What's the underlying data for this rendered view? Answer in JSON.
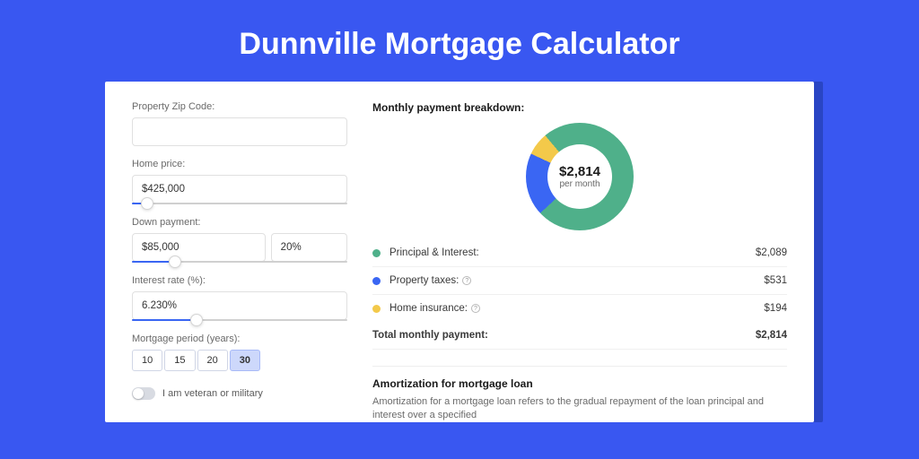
{
  "title": "Dunnville Mortgage Calculator",
  "form": {
    "zip": {
      "label": "Property Zip Code:",
      "value": ""
    },
    "home_price": {
      "label": "Home price:",
      "value": "$425,000",
      "slider_pct": 7
    },
    "down_payment": {
      "label": "Down payment:",
      "amount": "$85,000",
      "percent": "20%",
      "slider_pct": 20
    },
    "interest": {
      "label": "Interest rate (%):",
      "value": "6.230%",
      "slider_pct": 30
    },
    "period": {
      "label": "Mortgage period (years):",
      "options": [
        "10",
        "15",
        "20",
        "30"
      ],
      "selected": "30"
    },
    "veteran": {
      "label": "I am veteran or military",
      "checked": false
    }
  },
  "breakdown": {
    "heading": "Monthly payment breakdown:",
    "total_display": "$2,814",
    "per_month": "per month",
    "items": [
      {
        "label": "Principal & Interest:",
        "amount": "$2,089",
        "color": "#4fb08a",
        "info": false
      },
      {
        "label": "Property taxes:",
        "amount": "$531",
        "color": "#3a66f3",
        "info": true
      },
      {
        "label": "Home insurance:",
        "amount": "$194",
        "color": "#f3c94a",
        "info": true
      }
    ],
    "total_label": "Total monthly payment:",
    "total_amount": "$2,814"
  },
  "chart_data": {
    "type": "pie",
    "title": "Monthly payment breakdown",
    "total": 2814,
    "unit": "USD per month",
    "series": [
      {
        "name": "Principal & Interest",
        "value": 2089,
        "color": "#4fb08a"
      },
      {
        "name": "Property taxes",
        "value": 531,
        "color": "#3a66f3"
      },
      {
        "name": "Home insurance",
        "value": 194,
        "color": "#f3c94a"
      }
    ]
  },
  "amortization": {
    "heading": "Amortization for mortgage loan",
    "text": "Amortization for a mortgage loan refers to the gradual repayment of the loan principal and interest over a specified"
  }
}
